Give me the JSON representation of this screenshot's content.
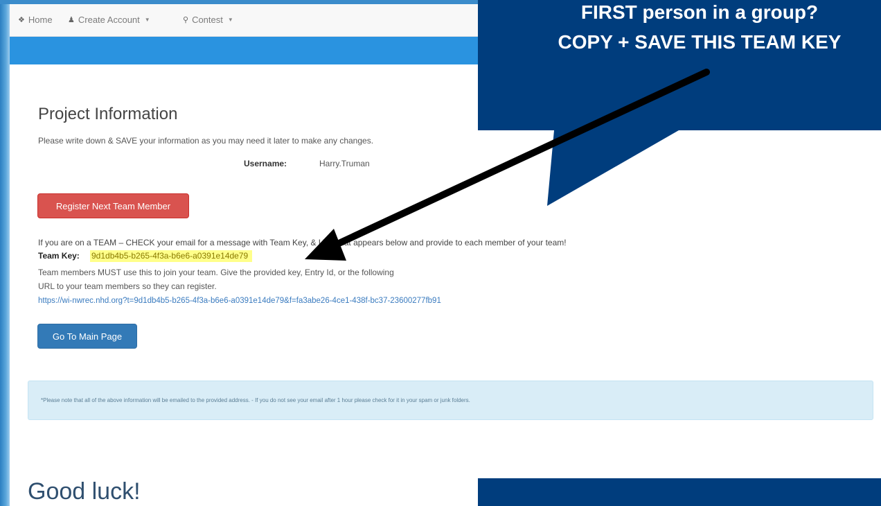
{
  "nav": {
    "home": "Home",
    "create_account": "Create Account",
    "contest": "Contest"
  },
  "main": {
    "title": "Project Information",
    "instruction": "Please write down & SAVE your information as you may need it later to make any changes.",
    "username_label": "Username:",
    "username_value": "Harry.Truman",
    "register_button": "Register Next Team Member",
    "team_message": "If you are on a TEAM – CHECK your email for a message with Team Key, & URL that appears below and provide to each member of your team!",
    "team_key_label": "Team Key:",
    "team_key_value": "9d1db4b5-b265-4f3a-b6e6-a0391e14de79",
    "members_line1": "Team members MUST use this to join your team. Give the provided key, Entry Id, or the following",
    "members_line2": "URL to your team members so they can register.",
    "team_url": "https://wi-nwrec.nhd.org?t=9d1db4b5-b265-4f3a-b6e6-a0391e14de79&f=fa3abe26-4ce1-438f-bc37-23600277fb91",
    "main_page_button": "Go To Main Page",
    "alert": "*Please note that all of the above information will be emailed to the provided address. - If you do not see your email after 1 hour please check for it in your spam or junk folders.",
    "good_luck": "Good luck!"
  },
  "callout": {
    "line1": "FIRST person in a group?",
    "line2": "COPY + SAVE THIS TEAM KEY"
  },
  "colors": {
    "callout_bg": "#003d7d",
    "navbar_accent": "#2a93e0",
    "danger_button": "#d9534f",
    "primary_button": "#337ab7",
    "key_highlight": "#ffff8a"
  }
}
